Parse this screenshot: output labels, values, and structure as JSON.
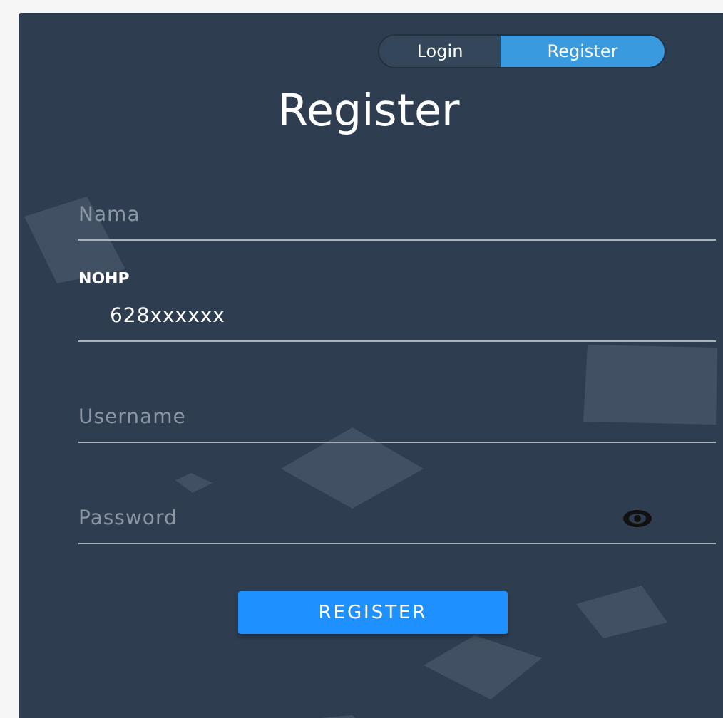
{
  "tabs": [
    {
      "label": "Login",
      "selected": false
    },
    {
      "label": "Register",
      "selected": true
    }
  ],
  "title": "Register",
  "fields": [
    {
      "kind": "text",
      "placeholder": "Nama"
    },
    {
      "kind": "text",
      "label": "NOHP",
      "value": "628xxxxxx"
    },
    {
      "kind": "text",
      "placeholder": "Username"
    },
    {
      "kind": "password",
      "placeholder": "Password"
    }
  ],
  "submit_button": "REGISTER"
}
